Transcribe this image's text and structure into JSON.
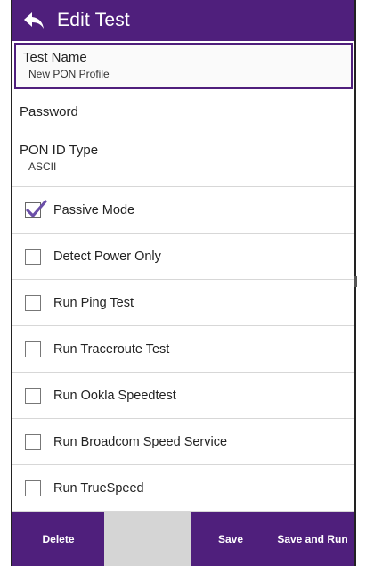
{
  "titlebar": {
    "title": "Edit Test",
    "back_icon": "back-arrow-icon"
  },
  "fields": {
    "test_name": {
      "label": "Test Name",
      "value": "New PON Profile"
    },
    "password": {
      "label": "Password"
    },
    "pon_id_type": {
      "label": "PON ID Type",
      "value": "ASCII"
    }
  },
  "options": [
    {
      "label": "Passive Mode",
      "checked": true
    },
    {
      "label": "Detect Power Only",
      "checked": false
    },
    {
      "label": "Run Ping Test",
      "checked": false
    },
    {
      "label": "Run Traceroute Test",
      "checked": false
    },
    {
      "label": "Run Ookla Speedtest",
      "checked": false
    },
    {
      "label": "Run Broadcom Speed Service",
      "checked": false
    },
    {
      "label": "Run TrueSpeed",
      "checked": false
    }
  ],
  "buttons": {
    "delete": "Delete",
    "save": "Save",
    "save_and_run": "Save and Run"
  },
  "colors": {
    "accent": "#4f1f7c",
    "check": "#6b4fa8"
  }
}
